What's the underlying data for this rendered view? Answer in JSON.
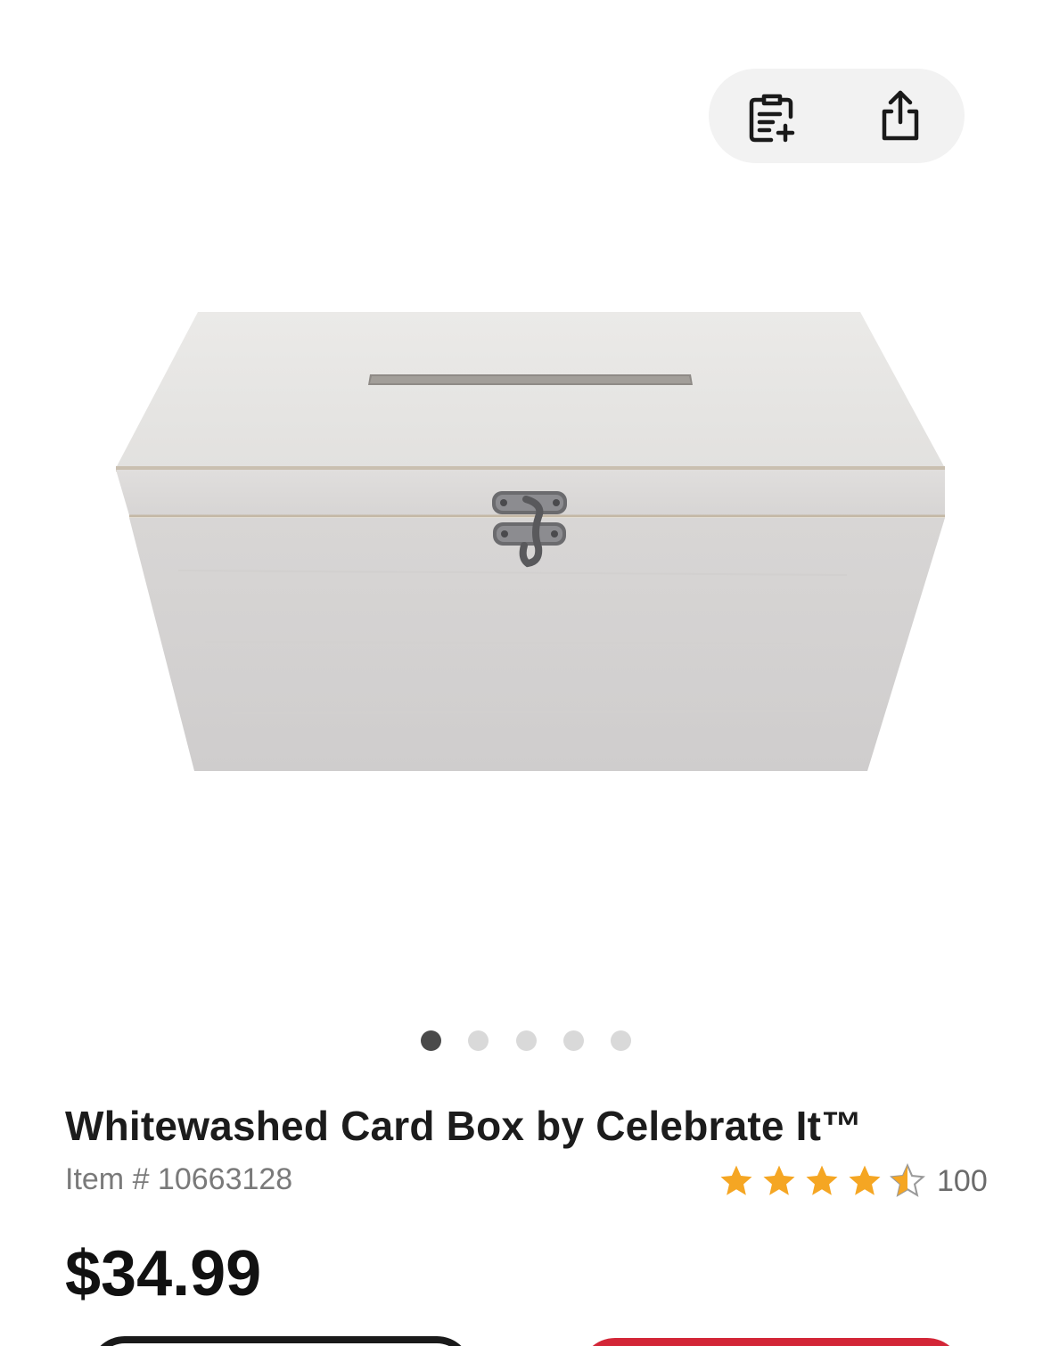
{
  "header": {
    "actions": [
      {
        "icon": "clipboard-add-icon"
      },
      {
        "icon": "share-icon"
      }
    ]
  },
  "gallery": {
    "image": "whitewashed-card-box-image",
    "total_images": 5,
    "active_index": 0
  },
  "product": {
    "title": "Whitewashed Card Box by Celebrate It™",
    "item_number": "Item # 10663128",
    "rating": 4.5,
    "rating_count": "100",
    "price": "$34.99"
  },
  "colors": {
    "star": "#f5a623",
    "primary_button": "#d32637",
    "dot_active": "#4a4a4a",
    "dot_inactive": "#d9d9d9"
  }
}
